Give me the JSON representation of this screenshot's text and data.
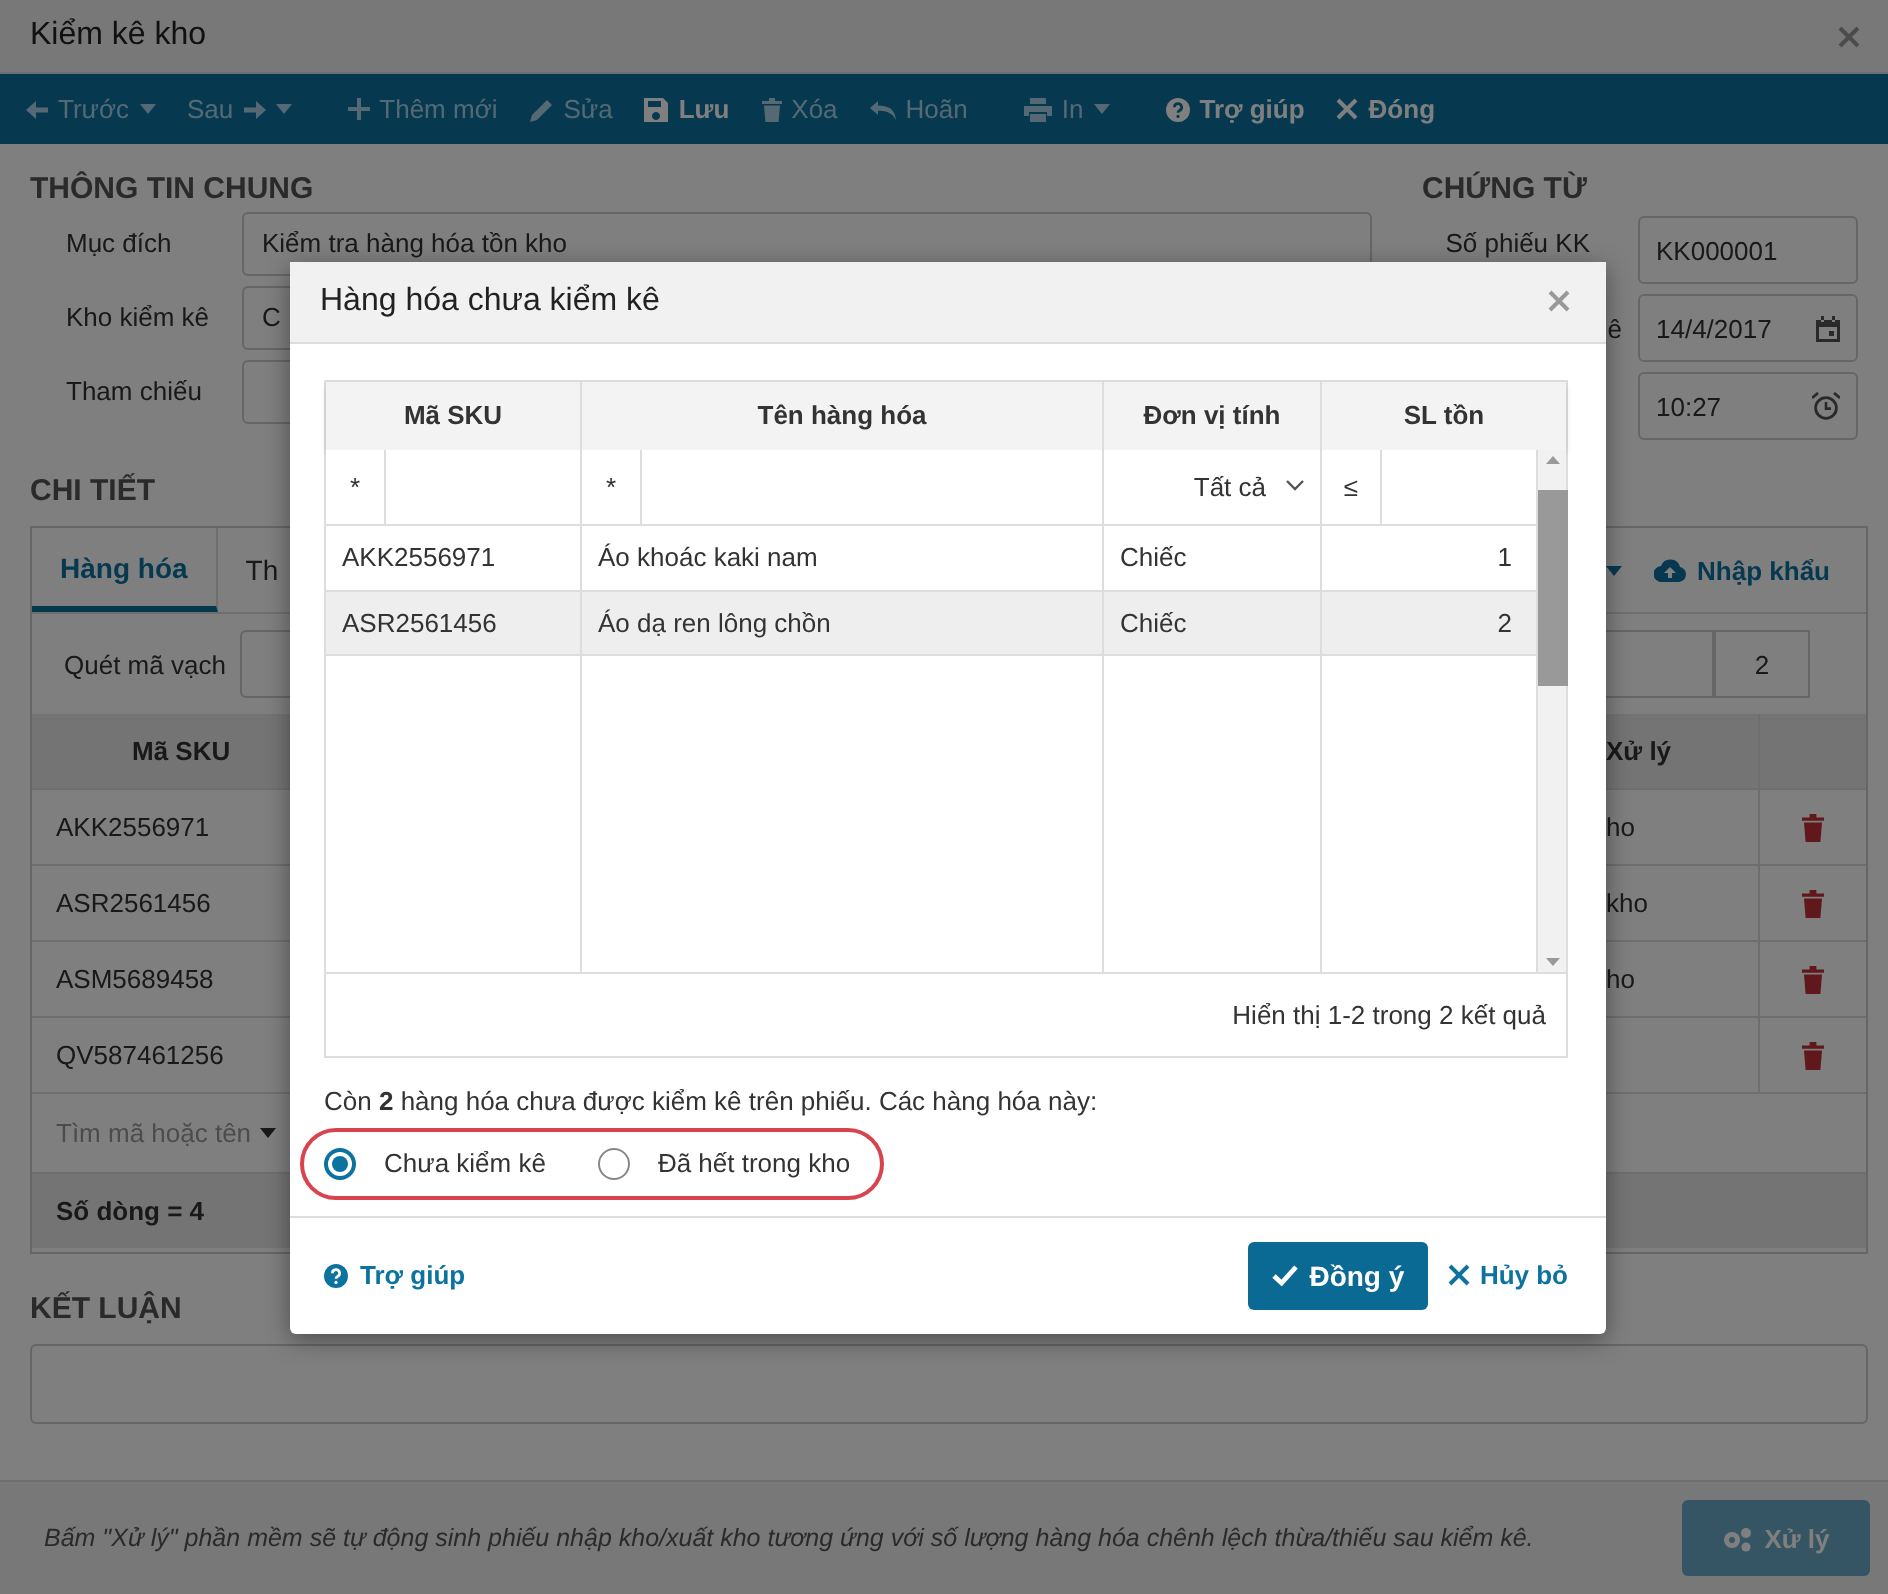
{
  "window": {
    "title": "Kiểm kê kho"
  },
  "toolbar": [
    {
      "kind": "previous",
      "label": "Trước",
      "dropdown": true,
      "disabled": true
    },
    {
      "kind": "next",
      "label": "Sau",
      "dropdown": true,
      "disabled": true
    },
    {
      "kind": "add",
      "label": "Thêm mới",
      "dropdown": false,
      "disabled": true
    },
    {
      "kind": "edit",
      "label": "Sửa",
      "dropdown": false,
      "disabled": true
    },
    {
      "kind": "save",
      "label": "Lưu",
      "dropdown": false,
      "disabled": false
    },
    {
      "kind": "delete",
      "label": "Xóa",
      "dropdown": false,
      "disabled": true
    },
    {
      "kind": "undo",
      "label": "Hoãn",
      "dropdown": false,
      "disabled": true
    },
    {
      "kind": "print",
      "label": "In",
      "dropdown": true,
      "disabled": true
    },
    {
      "kind": "help",
      "label": "Trợ giúp",
      "dropdown": false,
      "disabled": false
    },
    {
      "kind": "close",
      "label": "Đóng",
      "dropdown": false,
      "disabled": false
    }
  ],
  "general": {
    "heading": "THÔNG TIN CHUNG",
    "fields": [
      {
        "label": "Mục đích",
        "value": "Kiểm tra hàng hóa tồn kho"
      },
      {
        "label": "Kho kiểm kê",
        "value": "C"
      },
      {
        "label": "Tham chiếu"
      }
    ]
  },
  "voucher": {
    "heading": "CHỨNG TỪ",
    "fields": [
      {
        "kind": "text",
        "label": "Số phiếu KK",
        "value": "KK000001"
      },
      {
        "kind": "date",
        "label": "ê",
        "value": "14/4/2017"
      },
      {
        "kind": "time",
        "value": "10:27"
      }
    ]
  },
  "detail": {
    "heading": "CHI TIẾT",
    "tabs": [
      {
        "label": "Hàng hóa",
        "selected": true
      },
      {
        "label": "Th",
        "selected": false
      }
    ],
    "import": "Nhập khẩu",
    "barcode": {
      "label": "Quét mã vạch",
      "quantity": "2"
    },
    "columns": [
      "Mã SKU",
      "Xử lý"
    ],
    "rows": [
      {
        "sku": "AKK2556971",
        "status": "ho"
      },
      {
        "sku": "ASR2561456",
        "status": "kho"
      },
      {
        "sku": "ASM5689458",
        "status": "ho"
      },
      {
        "sku": "QV587461256"
      }
    ],
    "search": {
      "placeholder": "Tìm mã hoặc tên"
    },
    "footer": "Số dòng = 4"
  },
  "conclusion": {
    "heading": "KẾT LUẬN"
  },
  "bottom": {
    "note": "Bấm \"Xử lý\" phần mềm sẽ tự động sinh phiếu nhập kho/xuất kho tương ứng với số lượng hàng hóa chênh lệch thừa/thiếu sau kiểm kê.",
    "button": {
      "label": "Xử lý",
      "disabled": true
    }
  },
  "dialog": {
    "title": "Hàng hóa chưa kiểm kê",
    "columns": [
      "Mã SKU",
      "Tên hàng hóa",
      "Đơn vị tính",
      "SL tồn"
    ],
    "filters": [
      {
        "kind": "text",
        "operator": "*"
      },
      {
        "kind": "text",
        "operator": "*"
      },
      {
        "kind": "select",
        "value": "Tất cả"
      },
      {
        "kind": "text",
        "operator": "≤"
      }
    ],
    "rows": [
      {
        "sku": "AKK2556971",
        "name": "Áo khoác kaki nam",
        "unit": "Chiếc",
        "stock": "1",
        "selected": false
      },
      {
        "sku": "ASR2561456",
        "name": "Áo dạ ren lông chồn",
        "unit": "Chiếc",
        "stock": "2",
        "selected": true
      }
    ],
    "pagination": "Hiển thị 1-2 trong 2 kết quả",
    "message": "Còn **2** hàng hóa chưa được kiểm kê trên phiếu. Các hàng hóa này:",
    "options": [
      {
        "label": "Chưa kiểm kê",
        "selected": true
      },
      {
        "label": "Đã hết trong kho",
        "selected": false
      }
    ],
    "help": "Trợ giúp",
    "ok": "Đồng ý",
    "cancel": "Hủy bỏ"
  }
}
